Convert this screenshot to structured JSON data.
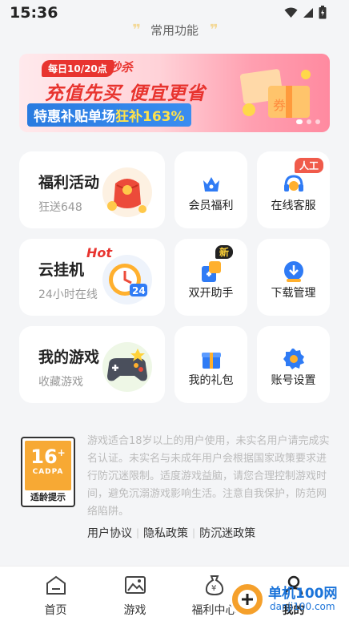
{
  "status_bar": {
    "time": "15:36"
  },
  "header": {
    "section_title": "常用功能"
  },
  "banner": {
    "tag": "每日10/20点",
    "flash_sale": "秒杀",
    "headline": "充值先买 便宜更省",
    "subline_prefix": "特惠补贴单场",
    "subline_highlight": "狂补163%",
    "box_text": "券"
  },
  "big_cards": [
    {
      "title": "福利活动",
      "subtitle": "狂送648",
      "illustration": "red-envelope-icon"
    },
    {
      "title": "云挂机",
      "subtitle": "24小时在线",
      "hot": "Hot",
      "illustration": "clock-24-icon"
    },
    {
      "title": "我的游戏",
      "subtitle": "收藏游戏",
      "illustration": "gamepad-icon"
    }
  ],
  "small_cards": [
    {
      "label": "会员福利",
      "icon": "crown-icon"
    },
    {
      "label": "在线客服",
      "icon": "headset-icon",
      "badge": "人工"
    },
    {
      "label": "双开助手",
      "icon": "dual-open-icon",
      "badge": "新"
    },
    {
      "label": "下载管理",
      "icon": "download-icon"
    },
    {
      "label": "我的礼包",
      "icon": "gift-icon"
    },
    {
      "label": "账号设置",
      "icon": "settings-gear-icon"
    }
  ],
  "age_rating": {
    "age": "16",
    "plus": "+",
    "org": "CADPA",
    "tip": "适龄提示"
  },
  "notice": "游戏适合18岁以上的用户使用，未实名用户请完成实名认证。未实名与未成年用户会根据国家政策要求进行防沉迷限制。适度游戏益脑，请您合理控制游戏时间，避免沉溺游戏影响生活。注意自我保护，防范网络陷阱。",
  "links": [
    "用户协议",
    "隐私政策",
    "防沉迷政策"
  ],
  "tabs": [
    {
      "label": "首页",
      "icon": "home-icon"
    },
    {
      "label": "游戏",
      "icon": "game-image-icon"
    },
    {
      "label": "福利中心",
      "icon": "money-bag-icon"
    },
    {
      "label": "我的",
      "icon": "profile-icon",
      "active": true
    }
  ],
  "watermark": {
    "text": "单机100网",
    "url": "danji100.com"
  },
  "colors": {
    "accent_blue": "#2f7bf5",
    "hot_red": "#e8342f",
    "age_orange": "#f7a934",
    "badge_red": "#f05b4b"
  }
}
